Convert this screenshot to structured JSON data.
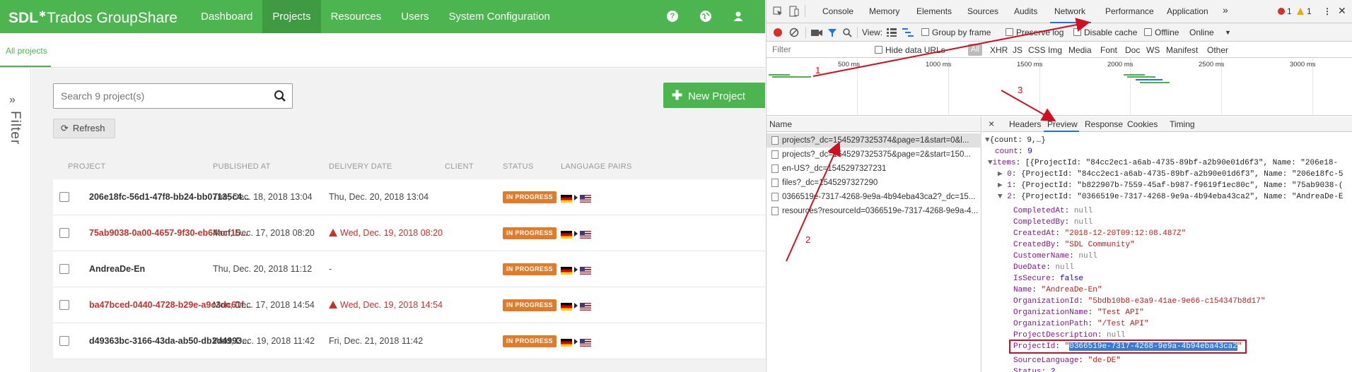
{
  "app": {
    "logo": {
      "brand": "SDL",
      "product": "Trados GroupShare"
    },
    "nav": [
      {
        "label": "Dashboard",
        "active": false
      },
      {
        "label": "Projects",
        "active": true
      },
      {
        "label": "Resources",
        "active": false
      },
      {
        "label": "Users",
        "active": false
      },
      {
        "label": "System Configuration",
        "active": false
      }
    ],
    "icons": {
      "help": "?",
      "globe": "globe-icon",
      "user": "user-icon"
    },
    "subtab": "All projects",
    "filter_label": "Filter",
    "search": {
      "placeholder": "Search 9 project(s)"
    },
    "new_project_label": "New Project",
    "refresh_label": "Refresh",
    "columns": [
      "PROJECT",
      "PUBLISHED AT",
      "DELIVERY DATE",
      "CLIENT",
      "STATUS",
      "LANGUAGE PAIRS"
    ],
    "rows": [
      {
        "name": "206e18fc-56d1-47f8-bb24-bb07135c4...",
        "published": "Tue, Dec. 18, 2018 13:04",
        "delivery": "Thu, Dec. 20, 2018 13:04",
        "client": "",
        "status": "IN PROGRESS",
        "overdue": false
      },
      {
        "name": "75ab9038-0a00-4657-9f30-eb64acf15...",
        "published": "Mon, Dec. 17, 2018 08:20",
        "delivery": "Wed, Dec. 19, 2018 08:20",
        "client": "",
        "status": "IN PROGRESS",
        "overdue": true
      },
      {
        "name": "AndreaDe-En",
        "published": "Thu, Dec. 20, 2018 11:12",
        "delivery": "-",
        "client": "",
        "status": "IN PROGRESS",
        "overdue": false
      },
      {
        "name": "ba47bced-0440-4728-b29e-a9c3dc61f...",
        "published": "Mon, Dec. 17, 2018 14:54",
        "delivery": "Wed, Dec. 19, 2018 14:54",
        "client": "",
        "status": "IN PROGRESS",
        "overdue": true
      },
      {
        "name": "d49363bc-3166-43da-ab50-db2d4993...",
        "published": "Wed, Dec. 19, 2018 11:42",
        "delivery": "Fri, Dec. 21, 2018 11:42",
        "client": "",
        "status": "IN PROGRESS",
        "overdue": false
      }
    ],
    "colors": {
      "brand_green": "#4cb54f",
      "status_orange": "#e07b2c",
      "overdue_red": "#c9302c"
    }
  },
  "devtools": {
    "tabs": [
      "Console",
      "Memory",
      "Elements",
      "Sources",
      "Audits",
      "Network",
      "Performance",
      "Application"
    ],
    "active_tab": "Network",
    "more": "»",
    "errors": "1",
    "warnings": "1",
    "toolbar": {
      "view": "View:",
      "group_by_frame": "Group by frame",
      "preserve_log": "Preserve log",
      "disable_cache": "Disable cache",
      "offline": "Offline",
      "throttle": "Online"
    },
    "filter": {
      "placeholder": "Filter",
      "hide_data_urls": "Hide data URLs",
      "all": "All",
      "types": [
        "XHR",
        "JS",
        "CSS",
        "Img",
        "Media",
        "Font",
        "Doc",
        "WS",
        "Manifest",
        "Other"
      ]
    },
    "timeline_labels": [
      "500 ms",
      "1000 ms",
      "1500 ms",
      "2000 ms",
      "2500 ms",
      "3000 ms"
    ],
    "name_header": "Name",
    "requests": [
      "projects?_dc=1545297325374&page=1&start=0&l...",
      "projects?_dc=1545297325375&page=2&start=150...",
      "en-US?_dc=1545297327231",
      "files?_dc=1545297327290",
      "0366519e-7317-4268-9e9a-4b94eba43ca2?_dc=15...",
      "resources?resourceId=0366519e-7317-4268-9e9a-4..."
    ],
    "detail_close": "×",
    "detail_tabs": [
      "Headers",
      "Preview",
      "Response",
      "Cookies",
      "Timing"
    ],
    "active_detail_tab": "Preview",
    "preview": {
      "root": "{count: 9,…}",
      "count_key": "count",
      "count_val": "9",
      "items_key": "items",
      "items_summary": "[{ProjectId: \"84cc2ec1-a6ab-4735-89bf-a2b90e01d6f3\", Name: \"206e18-",
      "item0": "{ProjectId: \"84cc2ec1-a6ab-4735-89bf-a2b90e01d6f3\", Name: \"206e18fc-5",
      "item1": "{ProjectId: \"b822907b-7559-45af-b987-f9619f1ec80c\", Name: \"75ab9038-(",
      "item2": "{ProjectId: \"0366519e-7317-4268-9e9a-4b94eba43ca2\", Name: \"AndreaDe-E",
      "fields": [
        {
          "key": "CompletedAt",
          "val": "null",
          "type": "null"
        },
        {
          "key": "CompletedBy",
          "val": "null",
          "type": "null"
        },
        {
          "key": "CreatedAt",
          "val": "\"2018-12-20T09:12:08.487Z\"",
          "type": "string"
        },
        {
          "key": "CreatedBy",
          "val": "\"SDL Community\"",
          "type": "string"
        },
        {
          "key": "CustomerName",
          "val": "null",
          "type": "null"
        },
        {
          "key": "DueDate",
          "val": "null",
          "type": "null"
        },
        {
          "key": "IsSecure",
          "val": "false",
          "type": "bool"
        },
        {
          "key": "Name",
          "val": "\"AndreaDe-En\"",
          "type": "string"
        },
        {
          "key": "OrganizationId",
          "val": "\"5bdb10b8-e3a9-41ae-9e66-c154347b8d17\"",
          "type": "string"
        },
        {
          "key": "OrganizationName",
          "val": "\"Test API\"",
          "type": "string"
        },
        {
          "key": "OrganizationPath",
          "val": "\"/Test API\"",
          "type": "string"
        },
        {
          "key": "ProjectDescription",
          "val": "null",
          "type": "null"
        }
      ],
      "project_id_key": "ProjectId",
      "project_id_val": "0366519e-7317-4268-9e9a-4b94eba43ca2",
      "after_fields": [
        {
          "key": "SourceLanguage",
          "val": "\"de-DE\"",
          "type": "string"
        },
        {
          "key": "Status",
          "val": "2",
          "type": "number"
        }
      ]
    }
  },
  "annotations": [
    "1",
    "2",
    "3"
  ],
  "annotation_color": "#d01020"
}
